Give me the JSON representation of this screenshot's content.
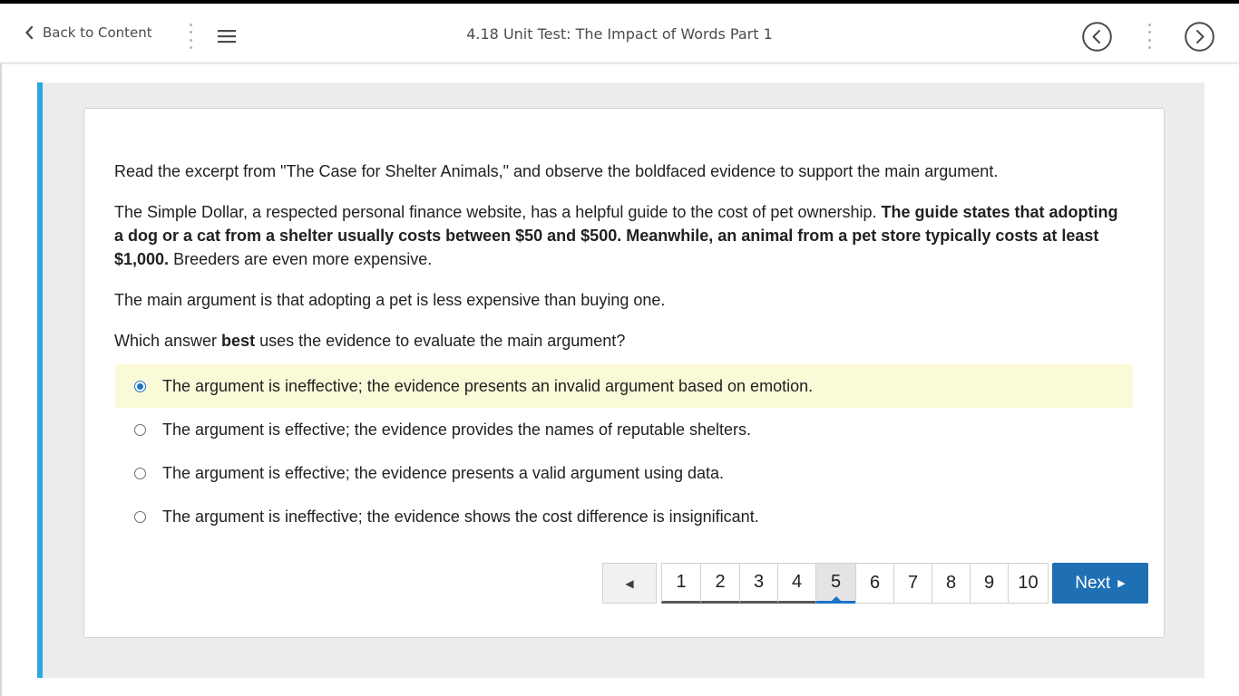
{
  "header": {
    "back_label": "Back to Content",
    "title": "4.18 Unit Test: The Impact of Words Part 1",
    "icons": {
      "back": "chevron-left-icon",
      "menu": "hamburger-menu-icon",
      "prev": "circle-chevron-left-icon",
      "next": "circle-chevron-right-icon"
    }
  },
  "question": {
    "intro": "Read the excerpt from \"The Case for Shelter Animals,\" and observe the boldfaced evidence to support the main argument.",
    "excerpt": {
      "plain_before": "The Simple Dollar, a respected personal finance website, has a helpful guide to the cost of pet ownership. ",
      "bold": "The guide states that adopting a dog or a cat from a shelter usually costs between $50 and $500. Meanwhile, an animal from a pet store typically costs at least $1,000.",
      "plain_after": " Breeders are even more expensive."
    },
    "argument": "The main argument is that adopting a pet is less expensive than buying one.",
    "prompt": {
      "before": "Which answer ",
      "bold": "best",
      "after": " uses the evidence to evaluate the main argument?"
    },
    "options": [
      {
        "label": "The argument is ineffective; the evidence presents an invalid argument based on emotion.",
        "selected": true
      },
      {
        "label": "The argument is effective; the evidence provides the names of reputable shelters.",
        "selected": false
      },
      {
        "label": "The argument is effective; the evidence presents a valid argument using data.",
        "selected": false
      },
      {
        "label": "The argument is ineffective; the evidence shows the cost difference is insignificant.",
        "selected": false
      }
    ]
  },
  "pagination": {
    "prev_icon": "triangle-left-icon",
    "pages": [
      "1",
      "2",
      "3",
      "4",
      "5",
      "6",
      "7",
      "8",
      "9",
      "10"
    ],
    "current_page": "5",
    "next_label": "Next",
    "next_icon": "triangle-right-icon"
  },
  "colors": {
    "accent": "#29a8e0",
    "primary_button": "#1f6fb5",
    "selected_option_bg": "#fbfad8",
    "radio_selected": "#1a73c9"
  }
}
